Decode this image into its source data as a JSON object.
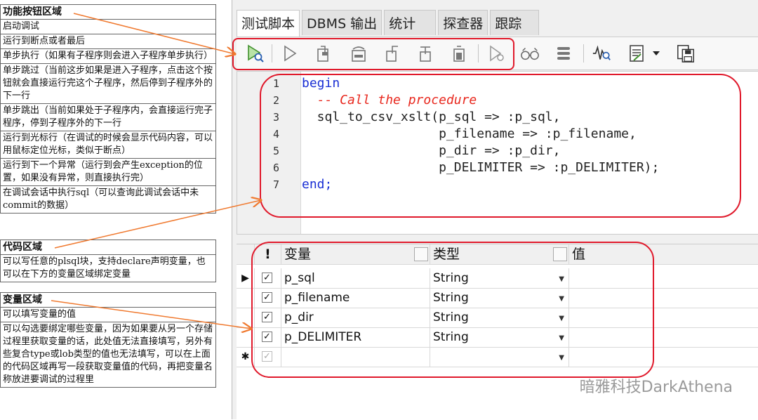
{
  "annotations": {
    "function_area": {
      "title": "功能按钮区域",
      "rows": [
        "启动调试",
        "运行到断点或者最后",
        "单步执行（如果有子程序则会进入子程序单步执行）",
        "单步跳过（当前这步如果是进入子程序，点击这个按钮就会直接运行完这个子程序，然后停到子程序外的下一行",
        "单步跳出（当前如果处于子程序内，会直接运行完子程序，停到子程序外的下一行",
        "运行到光标行（在调试的时候会显示代码内容，可以用鼠标定位光标，类似于断点）",
        "运行到下一个异常（运行到会产生exception的位置，如果没有异常，则直接执行完）",
        "在调试会话中执行sql（可以查询此调试会话中未commit的数据）"
      ]
    },
    "code_area": {
      "title": "代码区域",
      "rows": [
        "可以写任意的plsql块，支持declare声明变量，也可以在下方的变量区域绑定变量"
      ]
    },
    "variable_area": {
      "title": "变量区域",
      "rows": [
        "可以填写变量的值",
        "可以勾选要绑定哪些变量，因为如果要从另一个存储过程里获取变量的话，此处值无法直接填写，另外有些复合type或lob类型的值也无法填写，可以在上面的代码区域再写一段获取变量值的代码，再把变量名称放进要调试的过程里"
      ]
    }
  },
  "tabs": [
    "测试脚本",
    "DBMS 输出",
    "统计",
    "探查器",
    "跟踪"
  ],
  "toolbar": {
    "icons": [
      "start-debug-icon",
      "run-icon",
      "step-into-icon",
      "step-over-icon",
      "step-out-icon",
      "run-to-cursor-icon",
      "run-to-exception-icon",
      "execute-sql-icon",
      "watch-icon",
      "stack-icon",
      "chart-search-icon",
      "report-icon",
      "dropdown-icon",
      "save-icon"
    ]
  },
  "editor": {
    "line_numbers": [
      "1",
      "2",
      "3",
      "4",
      "5",
      "6",
      "7"
    ],
    "lines": [
      {
        "t": "begin",
        "kw": true
      },
      {
        "t": "  -- Call the procedure",
        "comment": true
      },
      {
        "t": "  sql_to_csv_xslt(p_sql => :p_sql,"
      },
      {
        "t": "                  p_filename => :p_filename,"
      },
      {
        "t": "                  p_dir => :p_dir,"
      },
      {
        "t": "                  p_DELIMITER => :p_DELIMITER);"
      },
      {
        "t": "end;",
        "kw": true
      }
    ]
  },
  "grid": {
    "headers": {
      "flag": "!",
      "name": "变量",
      "type": "类型",
      "value": "值"
    },
    "rows": [
      {
        "marker": "▶",
        "checked": "✓",
        "name": "p_sql",
        "type": "String",
        "value": ""
      },
      {
        "marker": "",
        "checked": "✓",
        "name": "p_filename",
        "type": "String",
        "value": ""
      },
      {
        "marker": "",
        "checked": "✓",
        "name": "p_dir",
        "type": "String",
        "value": ""
      },
      {
        "marker": "",
        "checked": "✓",
        "name": "p_DELIMITER",
        "type": "String",
        "value": ""
      },
      {
        "marker": "✱",
        "checked": "✓",
        "name": "",
        "type": "",
        "value": ""
      }
    ]
  },
  "watermark": "暗雅科技DarkAthena",
  "colors": {
    "highlight": "#e0192b",
    "arrow": "#f07a30",
    "keyword": "#1a2fd4",
    "comment": "#e8281e"
  }
}
